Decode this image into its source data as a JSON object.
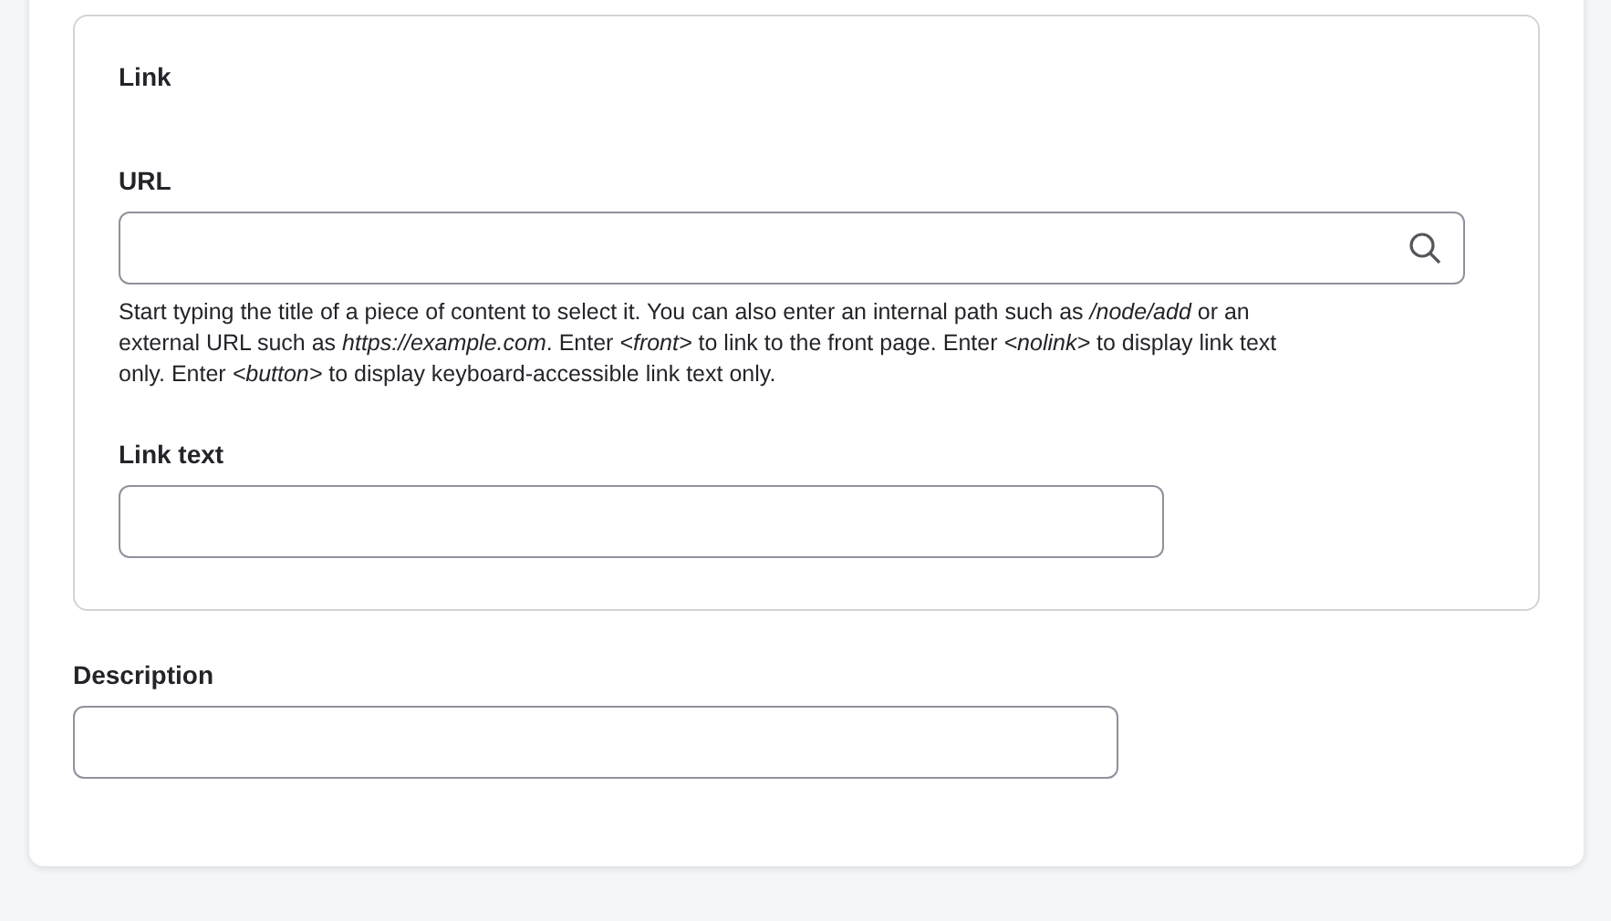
{
  "fieldset": {
    "legend": "Link",
    "url": {
      "label": "URL",
      "help": "Start typing the title of a piece of content to select it. You can also enter an internal path such as */node/add* or an external URL such as *https://example.com*. Enter *<front>* to link to the front page. Enter *<nolink>* to display link text only. Enter *<button>* to display keyboard-accessible link text only."
    },
    "link_text": {
      "label": "Link text"
    }
  },
  "description": {
    "label": "Description"
  }
}
